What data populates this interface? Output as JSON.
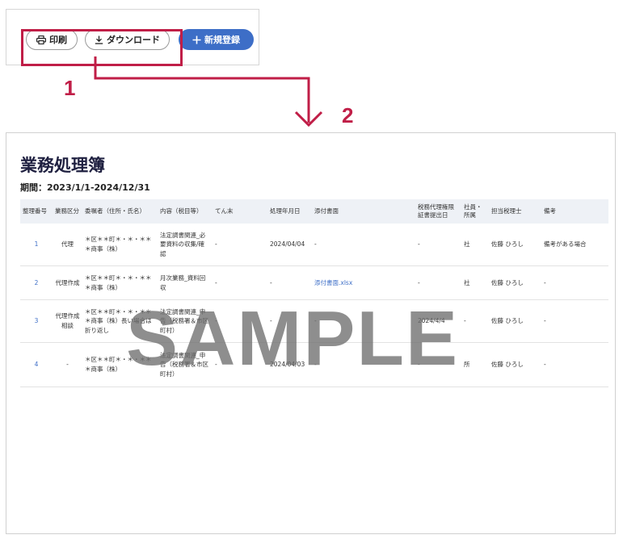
{
  "toolbar": {
    "print_label": "印刷",
    "download_label": "ダウンロード",
    "new_label": "新規登録"
  },
  "callouts": {
    "one": "1",
    "two": "2"
  },
  "colors": {
    "accent": "#c01e47",
    "primary_button": "#3d6ec7",
    "header_bg": "#eef1f6"
  },
  "icons": {
    "print": "printer-icon",
    "download": "download-icon",
    "new": "plus-icon"
  },
  "document": {
    "title": "業務処理簿",
    "period": "期間：2023/1/1-2024/12/31",
    "watermark": "SAMPLE",
    "columns": [
      "整理番号",
      "業務区分",
      "委嘱者（住所・氏名）",
      "内容（税目等）",
      "てん末",
      "処理年月日",
      "添付書面",
      "税務代理権限証書提出日",
      "社員・所属",
      "担当税理士",
      "備考"
    ],
    "rows": [
      [
        "1",
        "代理",
        "＊区＊＊町＊・＊・＊＊＊商事（株）",
        "法定調書関連_必要資料の収集/確認",
        "-",
        "2024/04/04",
        "-",
        "-",
        "社",
        "佐藤 ひろし",
        "備考がある場合"
      ],
      [
        "2",
        "代理作成",
        "＊区＊＊町＊・＊・＊＊＊商事（株）",
        "月次業務_資料回収",
        "-",
        "-",
        "添付書面.xlsx",
        "-",
        "社",
        "佐藤 ひろし",
        "-"
      ],
      [
        "3",
        "代理作成相談",
        "＊区＊＊町＊・＊・＊＊＊商事（株）長い場合は折り返し",
        "法定調書関連_申告（税務署＆市区町村）",
        "-",
        "-",
        "-",
        "2024/4/4",
        "-",
        "佐藤 ひろし",
        "-"
      ],
      [
        "4",
        "-",
        "＊区＊＊町＊・＊・＊＊＊商事（株）",
        "法定調書関連_申告（税務署＆市区町村）",
        "-",
        "2024/04/03",
        "-",
        "-",
        "所",
        "佐藤 ひろし",
        "-"
      ]
    ]
  }
}
